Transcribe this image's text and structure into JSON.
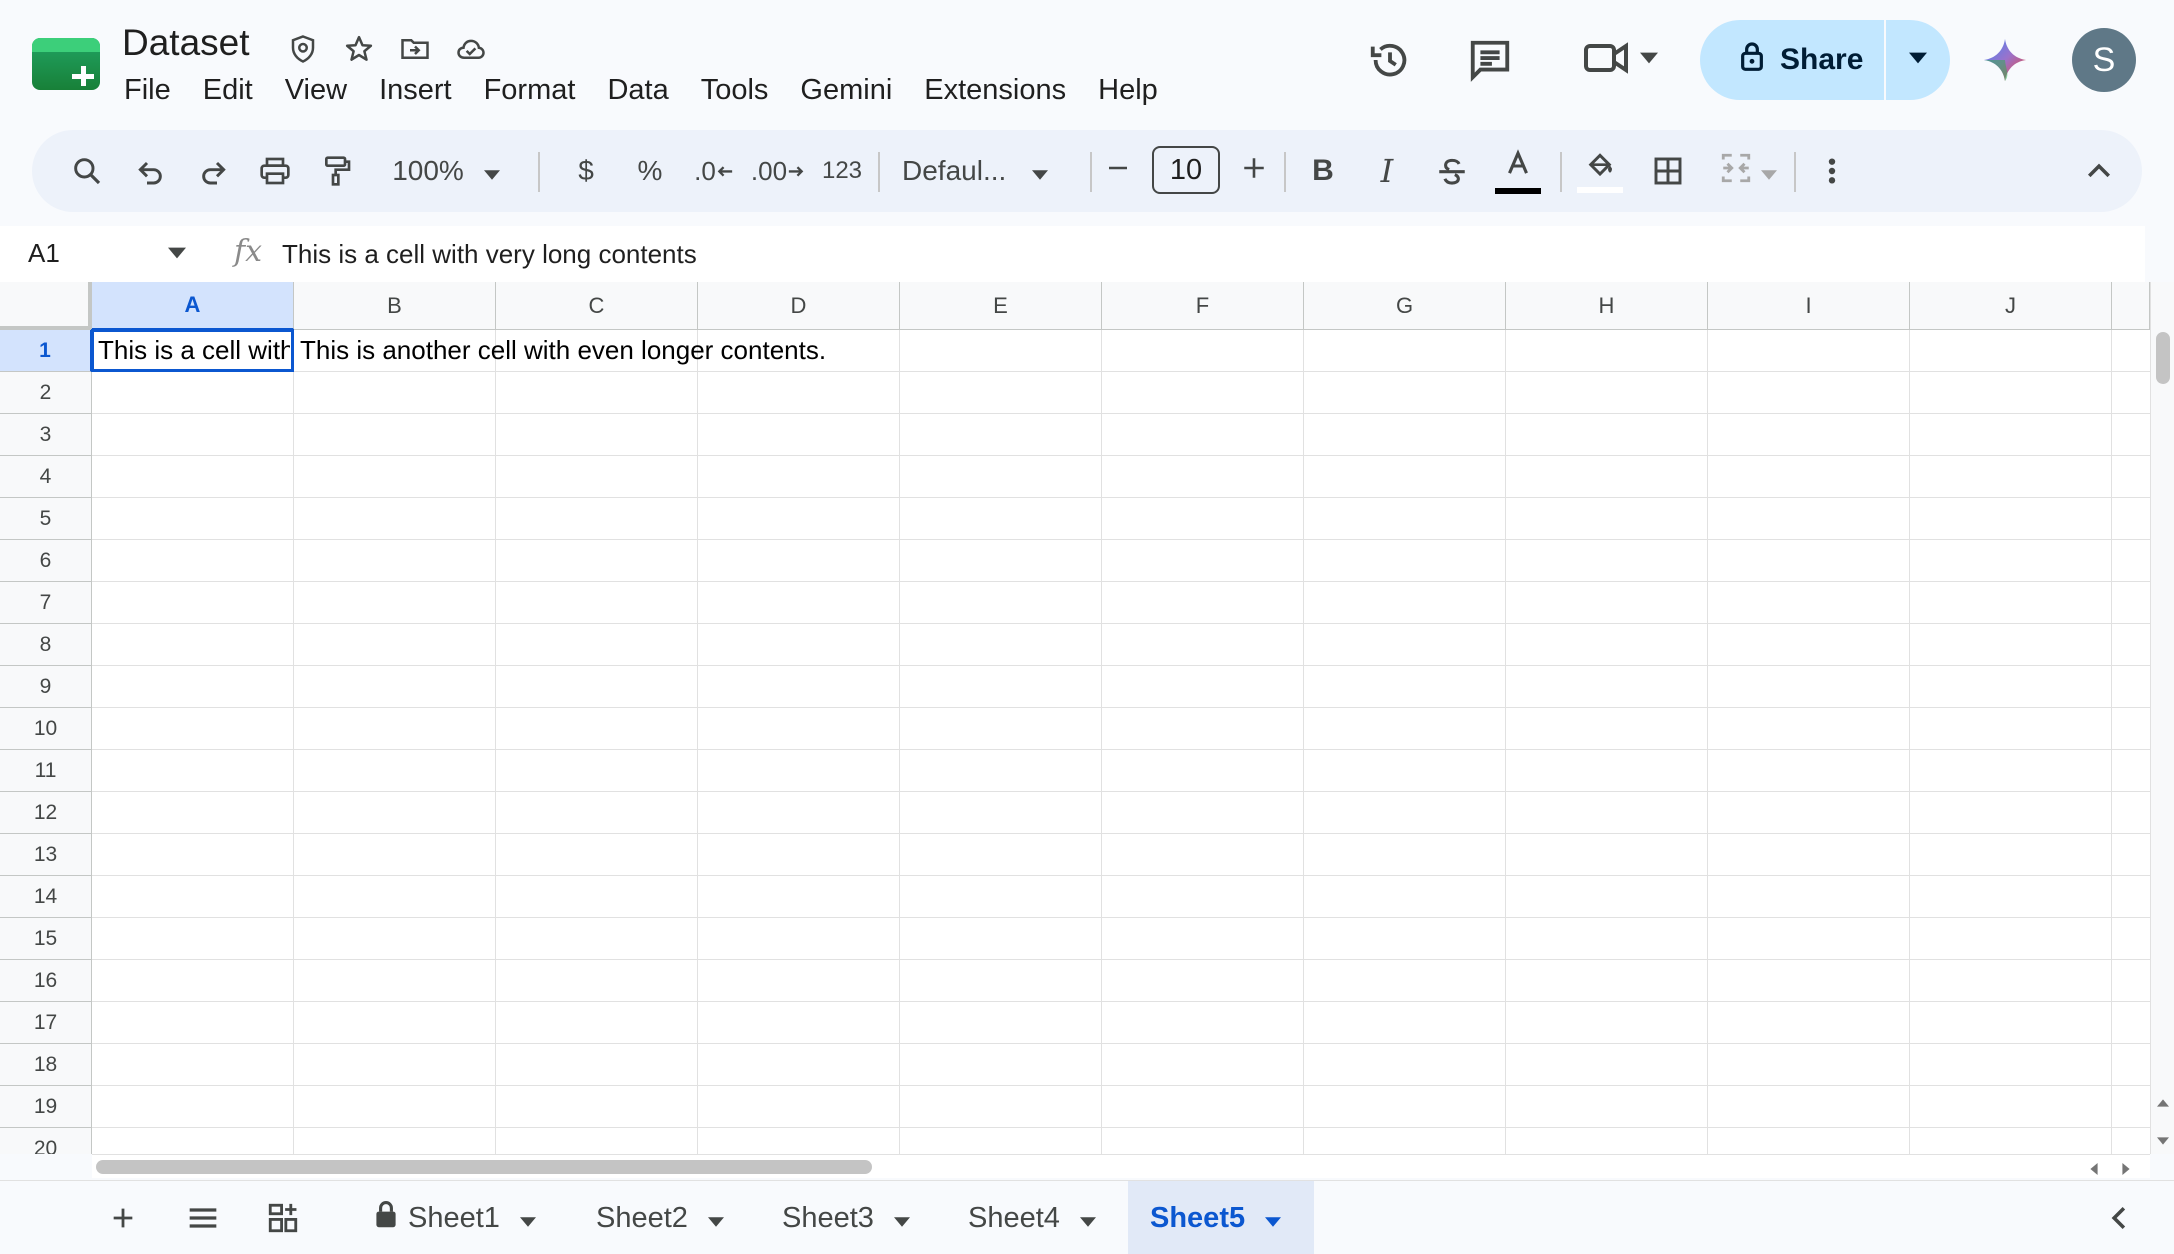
{
  "app": {
    "title": "Dataset",
    "menu": [
      "File",
      "Edit",
      "View",
      "Insert",
      "Format",
      "Data",
      "Tools",
      "Gemini",
      "Extensions",
      "Help"
    ],
    "share_label": "Share",
    "avatar_initial": "S",
    "colors": {
      "share_bg": "#c2e7ff",
      "accent": "#0b57d0",
      "selected_header": "#d3e3fd",
      "avatar": "#5f7887"
    }
  },
  "toolbar": {
    "zoom": "100%",
    "currency": "$",
    "percent": "%",
    "decrease_decimal": ".0",
    "increase_decimal": ".00",
    "number_format": "123",
    "font": "Defaul...",
    "font_size": "10",
    "bold": "B",
    "italic": "I"
  },
  "formula_bar": {
    "cell_ref": "A1",
    "fx": "fx",
    "content": "This is a cell with very long contents"
  },
  "grid": {
    "columns": [
      "A",
      "B",
      "C",
      "D",
      "E",
      "F",
      "G",
      "H",
      "I",
      "J"
    ],
    "rows": [
      "1",
      "2",
      "3",
      "4",
      "5",
      "6",
      "7",
      "8",
      "9",
      "10",
      "11",
      "12",
      "13",
      "14",
      "15",
      "16",
      "17",
      "18",
      "19",
      "20"
    ],
    "selected_cell": "A1",
    "cells": {
      "A1": "This is a cell with very long contents",
      "B1": "This is another cell with even longer contents."
    }
  },
  "sheets": {
    "tabs": [
      "Sheet1",
      "Sheet2",
      "Sheet3",
      "Sheet4",
      "Sheet5"
    ],
    "active": "Sheet5",
    "locked": "Sheet1"
  }
}
